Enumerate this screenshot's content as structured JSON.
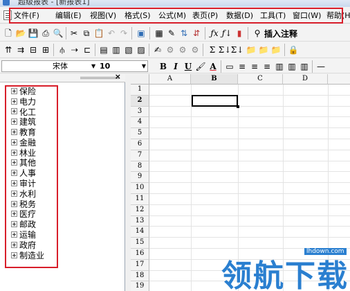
{
  "window": {
    "title": "超级报表 - [新报表1]"
  },
  "menu": {
    "items": [
      {
        "label": "文件(F)"
      },
      {
        "label": "编辑(E)"
      },
      {
        "label": "视图(V)"
      },
      {
        "label": "格式(S)"
      },
      {
        "label": "公式(M)"
      },
      {
        "label": "表页(P)"
      },
      {
        "label": "数据(D)"
      },
      {
        "label": "工具(T)"
      },
      {
        "label": "窗口(W)"
      },
      {
        "label": "帮助(H)"
      }
    ]
  },
  "toolbar": {
    "insert_comment_label": "插入注释",
    "sum_labels": [
      "Σ",
      "Σ↓",
      "Σ↓"
    ]
  },
  "format": {
    "font_name": "宋体",
    "font_size": "10",
    "bold": "B",
    "italic": "I",
    "underline": "U",
    "font_color": "A"
  },
  "tree": {
    "items": [
      "保险",
      "电力",
      "化工",
      "建筑",
      "教育",
      "金融",
      "林业",
      "其他",
      "人事",
      "审计",
      "水利",
      "税务",
      "医疗",
      "邮政",
      "运输",
      "政府",
      "制造业"
    ]
  },
  "grid": {
    "columns": [
      "A",
      "B",
      "C",
      "D"
    ],
    "rows": [
      "1",
      "2",
      "3",
      "4",
      "5",
      "6",
      "7",
      "8",
      "9",
      "10",
      "11",
      "12",
      "13",
      "14",
      "15",
      "16",
      "17",
      "18",
      "19"
    ],
    "active_cell": "B2"
  },
  "watermark": {
    "text": "领航下载",
    "url": "lhdown.com"
  },
  "colors": {
    "highlight": "#d81e2a",
    "watermark": "#2a7fd0"
  }
}
